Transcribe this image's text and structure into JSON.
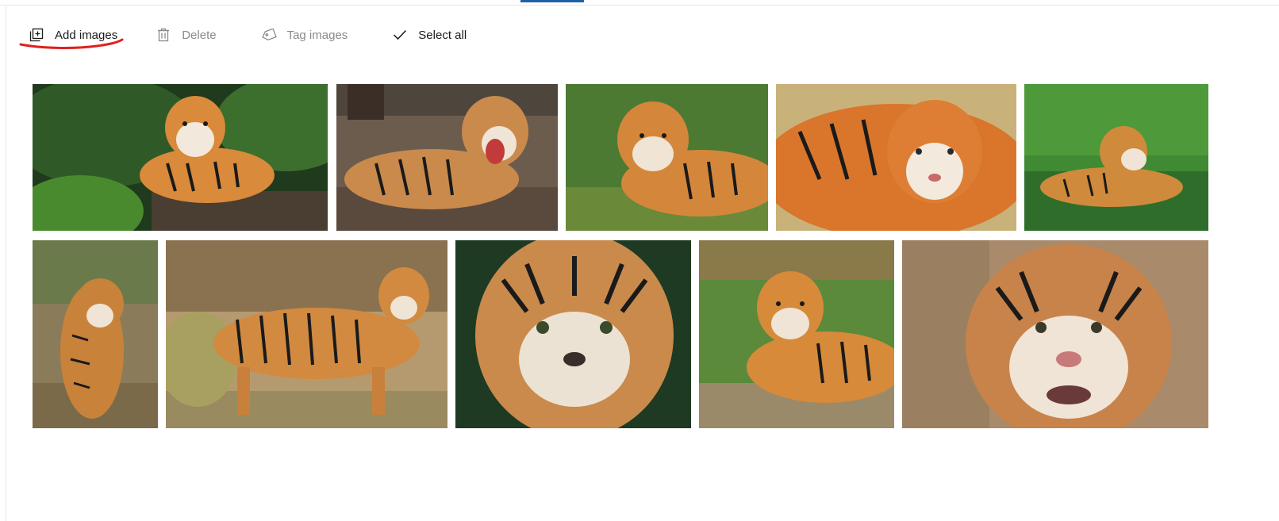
{
  "toolbar": {
    "add_images_label": "Add images",
    "delete_label": "Delete",
    "tag_images_label": "Tag images",
    "select_all_label": "Select all"
  },
  "icons": {
    "add": "add-image-icon",
    "delete": "trash-icon",
    "tag": "tag-icon",
    "select_all": "checkmark-icon"
  },
  "colors": {
    "accent": "#1f5fa8",
    "annotation": "#e0201f",
    "disabled_text": "#8a8a8a",
    "text": "#1a1a1a"
  },
  "gallery": {
    "row1": [
      {
        "subject": "tiger-lying-on-log-jungle",
        "bg": "#2f5a28",
        "fur": "#d98a3a"
      },
      {
        "subject": "tiger-roaring-on-log",
        "bg": "#6c5c4e",
        "fur": "#c98a4c"
      },
      {
        "subject": "tiger-lying-in-grass",
        "bg": "#4d7a32",
        "fur": "#d4873a"
      },
      {
        "subject": "tiger-resting-closeup",
        "bg": "#c9b27a",
        "fur": "#d9762c"
      },
      {
        "subject": "tiger-in-water",
        "bg": "#3f8a32",
        "fur": "#cf8a3c"
      }
    ],
    "row2": [
      {
        "subject": "tiger-walking-toward",
        "bg": "#8a7c5a",
        "fur": "#c8823a"
      },
      {
        "subject": "tiger-standing-side",
        "bg": "#b59a70",
        "fur": "#d18a3f"
      },
      {
        "subject": "tiger-face-closeup",
        "bg": "#1f3a22",
        "fur": "#c98a4c"
      },
      {
        "subject": "tiger-lying-on-rock",
        "bg": "#5a8a3a",
        "fur": "#d68a3a"
      },
      {
        "subject": "tiger-face-portrait",
        "bg": "#a98a6a",
        "fur": "#c8834a"
      }
    ]
  }
}
